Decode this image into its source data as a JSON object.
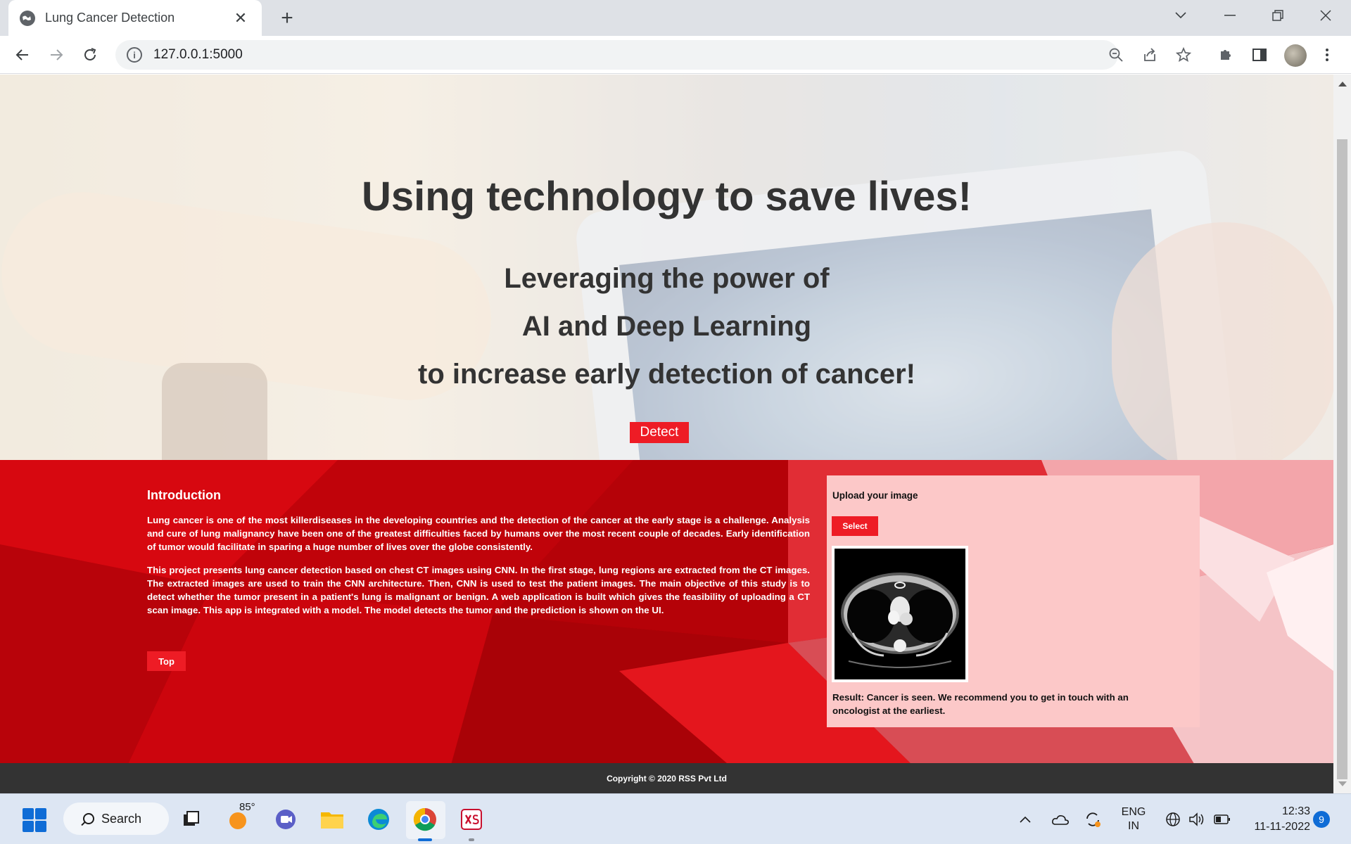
{
  "browser": {
    "tab_title": "Lung Cancer Detection",
    "tab_close": "✕",
    "new_tab": "+",
    "url": "127.0.0.1:5000",
    "info_glyph": "i"
  },
  "hero": {
    "heading": "Using technology to save lives!",
    "line1": "Leveraging the power of",
    "line2": "AI and Deep Learning",
    "line3": "to increase early detection of cancer!",
    "detect_label": "Detect"
  },
  "intro": {
    "title": "Introduction",
    "para1": "Lung cancer is one of the most killerdiseases in the developing countries and the detection of the cancer at the early stage is a challenge. Analysis and cure of lung malignancy have been one of the greatest difficulties faced by humans over the most recent couple of decades. Early identification of tumor would facilitate in sparing a huge number of lives over the globe consistently.",
    "para2": "This project presents lung cancer detection based on chest CT images using CNN. In the first stage, lung regions are extracted from the CT images. The extracted images are used to train the CNN architecture. Then, CNN is used to test the patient images. The main objective of this study is to detect whether the tumor present in a patient's lung is malignant or benign. A web application is built which gives the feasibility of uploading a CT scan image. This app is integrated with a model. The model detects the tumor and the prediction is shown on the UI.",
    "top_label": "Top"
  },
  "upload": {
    "label": "Upload your image",
    "select_label": "Select",
    "result": "Result: Cancer is seen. We recommend you to get in touch with an oncologist at the earliest."
  },
  "footer": {
    "copyright": "Copyright © 2020 RSS Pvt Ltd"
  },
  "taskbar": {
    "search_label": "Search",
    "weather_temp": "85°",
    "lang_line1": "ENG",
    "lang_line2": "IN",
    "time": "12:33",
    "date": "11-11-2022",
    "notification_count": "9"
  },
  "colors": {
    "accent_red": "#ee1c25",
    "section_red": "#c8040c",
    "panel_pink": "#fcc8c8",
    "footer_dark": "#333333"
  }
}
